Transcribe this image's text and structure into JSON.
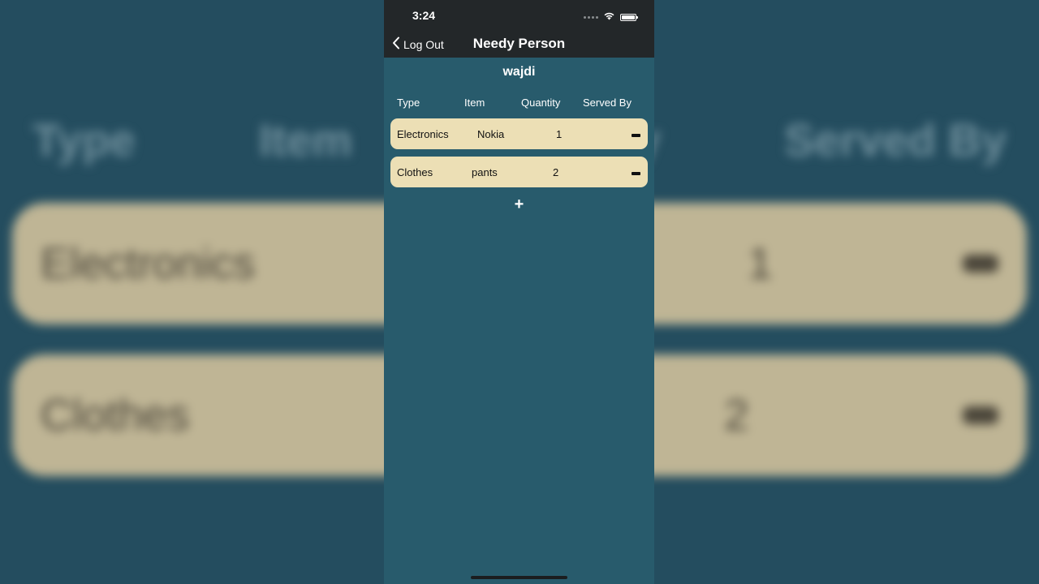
{
  "status_bar": {
    "time": "3:24"
  },
  "nav": {
    "back_label": "Log Out",
    "title": "Needy Person"
  },
  "user": {
    "name": "wajdi"
  },
  "table": {
    "headers": [
      "Type",
      "Item",
      "Quantity",
      "Served By"
    ],
    "rows": [
      {
        "type": "Electronics",
        "item": "Nokia",
        "quantity": "1",
        "served_by": ""
      },
      {
        "type": "Clothes",
        "item": "pants",
        "quantity": "2",
        "served_by": ""
      }
    ]
  },
  "actions": {
    "add_label": "+"
  },
  "colors": {
    "background": "#285b6c",
    "nav_background": "#232729",
    "row_background": "#ecdfb5"
  },
  "icons": {
    "back": "chevron-left-icon",
    "wifi": "wifi-icon",
    "battery": "battery-icon",
    "signal": "cellular-signal-icon",
    "remove": "minus-icon"
  }
}
